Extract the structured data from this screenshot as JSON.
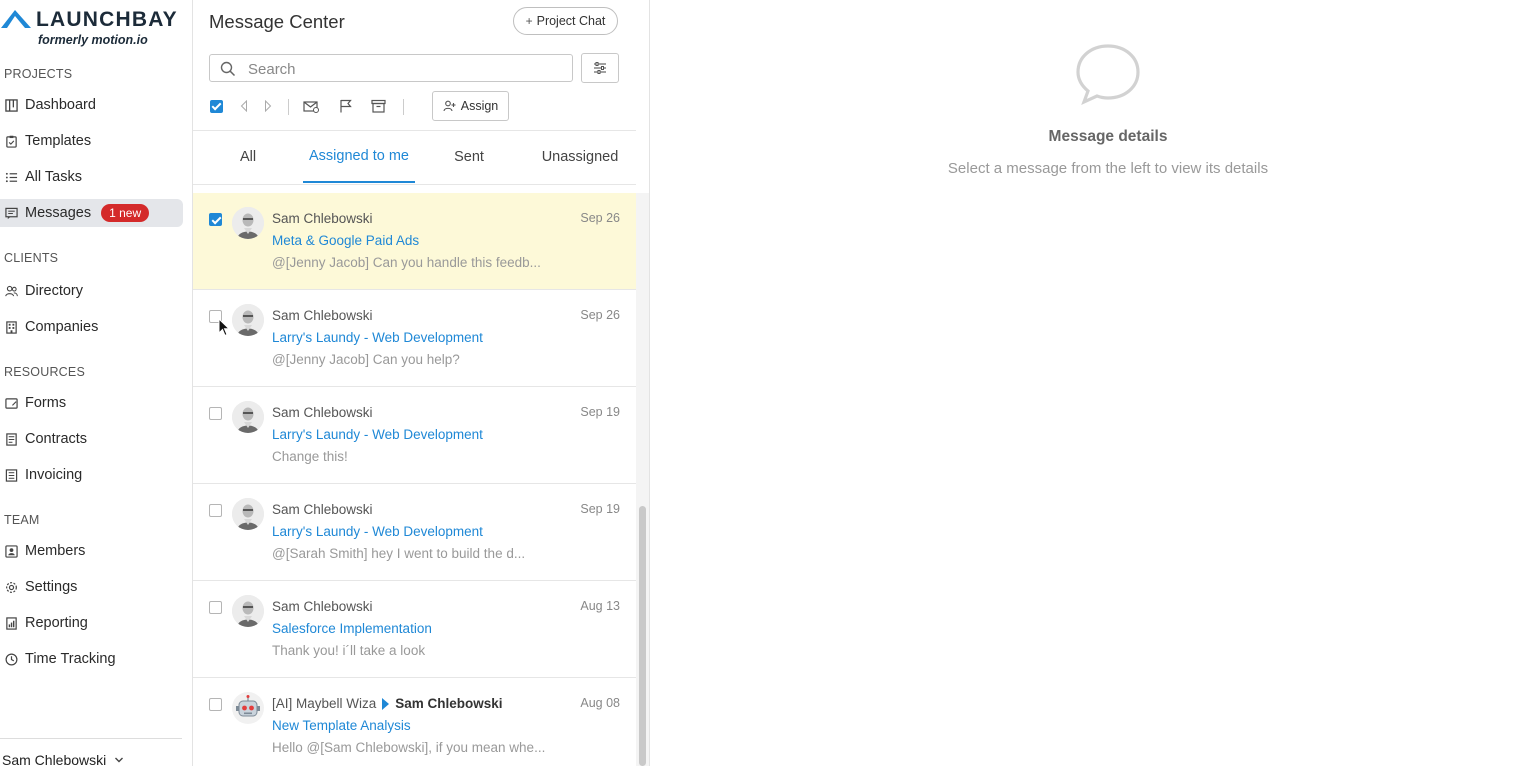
{
  "brand": {
    "name": "LAUNCHBAY",
    "subtitle": "formerly motion.io"
  },
  "sidebar": {
    "sections": {
      "projects": "PROJECTS",
      "clients": "CLIENTS",
      "resources": "RESOURCES",
      "team": "TEAM"
    },
    "items": {
      "dashboard": "Dashboard",
      "templates": "Templates",
      "all_tasks": "All Tasks",
      "messages": "Messages",
      "messages_badge": "1 new",
      "directory": "Directory",
      "companies": "Companies",
      "forms": "Forms",
      "contracts": "Contracts",
      "invoicing": "Invoicing",
      "members": "Members",
      "settings": "Settings",
      "reporting": "Reporting",
      "time_tracking": "Time Tracking"
    },
    "user": "Sam Chlebowski"
  },
  "message_center": {
    "title": "Message Center",
    "project_chat_label": "Project Chat",
    "search_placeholder": "Search",
    "assign_label": "Assign",
    "tabs": [
      "All",
      "Assigned to me",
      "Sent",
      "Unassigned"
    ],
    "active_tab": "Assigned to me",
    "messages": [
      {
        "sender": "Sam Chlebowski",
        "recipient": "",
        "date": "Sep 26",
        "subject": "Meta & Google Paid Ads",
        "preview": "@[Jenny Jacob] Can you handle this feedb...",
        "checked": true,
        "selected": true,
        "avatar": "person"
      },
      {
        "sender": "Sam Chlebowski",
        "recipient": "",
        "date": "Sep 26",
        "subject": "Larry's Laundy - Web Development",
        "preview": "@[Jenny Jacob] Can you help?",
        "checked": false,
        "selected": false,
        "avatar": "person"
      },
      {
        "sender": "Sam Chlebowski",
        "recipient": "",
        "date": "Sep 19",
        "subject": "Larry's Laundy - Web Development",
        "preview": "Change this!",
        "checked": false,
        "selected": false,
        "avatar": "person"
      },
      {
        "sender": "Sam Chlebowski",
        "recipient": "",
        "date": "Sep 19",
        "subject": "Larry's Laundy - Web Development",
        "preview": "@[Sarah Smith] hey I went to build the d...",
        "checked": false,
        "selected": false,
        "avatar": "person"
      },
      {
        "sender": "Sam Chlebowski",
        "recipient": "",
        "date": "Aug 13",
        "subject": "Salesforce Implementation",
        "preview": "Thank you! i´ll take a look",
        "checked": false,
        "selected": false,
        "avatar": "person"
      },
      {
        "sender": "[AI] Maybell Wiza",
        "recipient": "Sam Chlebowski",
        "date": "Aug 08",
        "subject": "New Template Analysis",
        "preview": "Hello @[Sam Chlebowski], if you mean whe...",
        "checked": false,
        "selected": false,
        "avatar": "robot"
      }
    ]
  },
  "details": {
    "title": "Message details",
    "subtitle": "Select a message from the left to view its details"
  },
  "colors": {
    "accent": "#1f88d6",
    "badge": "#d42a2a",
    "selected_row": "#fdf9d8",
    "brand_dark": "#1c2b39"
  }
}
